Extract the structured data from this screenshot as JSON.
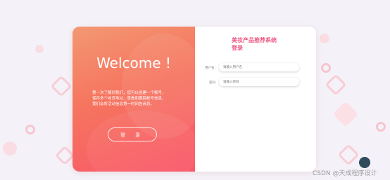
{
  "welcome_panel": {
    "heading": "Welcome !",
    "intro": "第一次了解到我们，您可以创建一个账号，\n保存多个收货地址、查看和跟踪帐号信息，\n我们会将活动信息第一时间告诉您。",
    "login_button": "登 录"
  },
  "login_form": {
    "title": "美妆产品推荐系统\n登录",
    "username_label": "用户名:",
    "username_placeholder": "请输入用户名",
    "password_label": "密码:",
    "password_placeholder": "请输入密码"
  },
  "watermark": "CSDN @天成程序设计",
  "colors": {
    "accent": "#ee5a86",
    "gradient_start": "#f39872",
    "gradient_end": "#f9576a",
    "background": "#f4f2f8"
  }
}
